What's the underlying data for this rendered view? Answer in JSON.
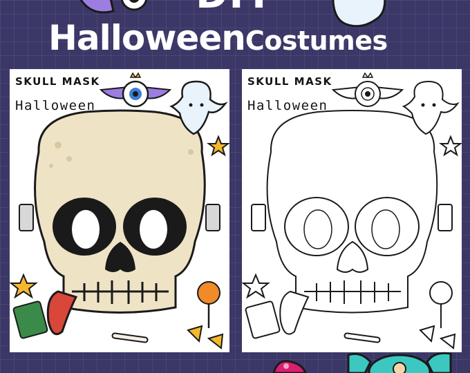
{
  "header": {
    "top_word": "DIY",
    "title_main": "Halloween",
    "title_sub": "Costumes"
  },
  "sheets": [
    {
      "label": "SKULL MASK",
      "subtitle": "Halloween",
      "style": "colored"
    },
    {
      "label": "SKULL MASK",
      "subtitle": "Halloween",
      "style": "outline"
    }
  ],
  "colors": {
    "background": "#3b3868",
    "skull_fill": "#efe3c6",
    "eye_sockets": "#1a1a1a",
    "tongue": "#d9463a",
    "star": "#f4b82e",
    "eyeball_wings": "#9b7ee0",
    "candy_teal": "#3cc8c0",
    "candy_magenta": "#d91e73"
  },
  "icons": [
    "winged-eyeball-icon",
    "ghost-icon",
    "star-icon",
    "candy-icon",
    "bone-icon",
    "candy-corn-icon",
    "pumpkin-lollipop-icon"
  ]
}
